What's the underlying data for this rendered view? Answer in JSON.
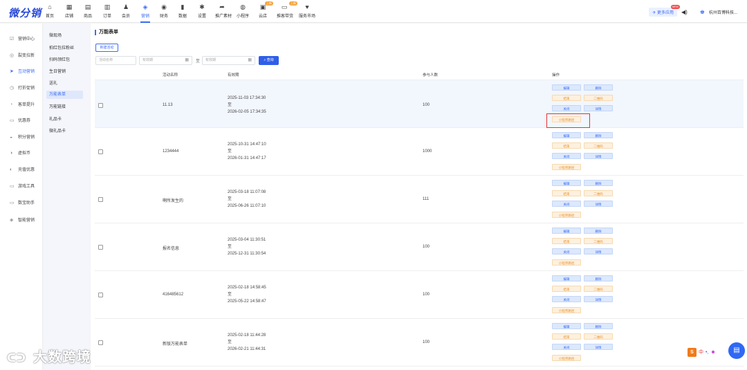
{
  "app": {
    "logo": "微分销"
  },
  "topnav": [
    {
      "label": "首页",
      "icon": "home-icon",
      "glyph": "⌂"
    },
    {
      "label": "店铺",
      "icon": "store-icon",
      "glyph": "▦"
    },
    {
      "label": "商品",
      "icon": "product-icon",
      "glyph": "▤"
    },
    {
      "label": "订单",
      "icon": "order-icon",
      "glyph": "▥"
    },
    {
      "label": "会员",
      "icon": "member-icon",
      "glyph": "♟"
    },
    {
      "label": "营销",
      "icon": "marketing-icon",
      "glyph": "◈"
    },
    {
      "label": "财务",
      "icon": "finance-icon",
      "glyph": "◉"
    },
    {
      "label": "数据",
      "icon": "data-icon",
      "glyph": "▮"
    },
    {
      "label": "设置",
      "icon": "settings-icon",
      "glyph": "✱"
    },
    {
      "label": "推广素材",
      "icon": "share-icon",
      "glyph": "➦"
    },
    {
      "label": "小程序",
      "icon": "miniprogram-icon",
      "glyph": "◍"
    },
    {
      "label": "云店",
      "icon": "cloud-store-icon",
      "glyph": "▣",
      "badge": "上新"
    },
    {
      "label": "推客带货",
      "icon": "promoter-icon",
      "glyph": "▭",
      "badge": "上新"
    },
    {
      "label": "服务市场",
      "icon": "service-market-icon",
      "glyph": "♥"
    }
  ],
  "topright": {
    "more_apps": "更多应用",
    "more_badge": "NEW",
    "company": "杭州百博科技..."
  },
  "sidebar1": [
    {
      "label": "营销中心",
      "glyph": "☑"
    },
    {
      "label": "裂变拉新",
      "glyph": "◎"
    },
    {
      "label": "互动营销",
      "glyph": "➤"
    },
    {
      "label": "打折促销",
      "glyph": "◷"
    },
    {
      "label": "客单提升",
      "glyph": "◔"
    },
    {
      "label": "优惠券",
      "glyph": "▭"
    },
    {
      "label": "积分营销",
      "glyph": "◒"
    },
    {
      "label": "虚拟币",
      "glyph": "◑"
    },
    {
      "label": "充值优惠",
      "glyph": "◐"
    },
    {
      "label": "游戏工具",
      "glyph": "▭"
    },
    {
      "label": "数宝助手",
      "glyph": "▭"
    },
    {
      "label": "智能营销",
      "glyph": "◈"
    }
  ],
  "sidebar2": [
    "微现场",
    "拍红包拉粉丝",
    "扫码领红包",
    "生日营销",
    "送礼",
    "万能表单",
    "万能链接",
    "礼品卡",
    "微礼品卡"
  ],
  "page": {
    "title": "万能表单",
    "new_button": "新建活动",
    "name_placeholder": "活动名称",
    "date_start_placeholder": "有效期",
    "date_to": "至",
    "date_end_placeholder": "有效期",
    "query_button": "查询"
  },
  "table": {
    "headers": [
      "活动名称",
      "有效期",
      "参与人数",
      "操作"
    ],
    "to_word": "至",
    "ops": {
      "edit": "编辑",
      "delete": "删除",
      "stop": "结束",
      "qrcode": "二维码",
      "close": "关闭",
      "detail": "详情",
      "mini_path": "小程序路径"
    },
    "rows": [
      {
        "name": "11.13",
        "start": "2025-11-03 17:34:30",
        "end": "2026-02-05 17:34:35",
        "count": "100"
      },
      {
        "name": "1234444",
        "start": "2025-10-31 14:47:10",
        "end": "2026-01-31 14:47:17",
        "count": "1000"
      },
      {
        "name": "啊所发生的",
        "start": "2025-03-18 11:07:08",
        "end": "2025-06-26 11:07:10",
        "count": "111"
      },
      {
        "name": "报名信息",
        "start": "2025-03-04 11:30:51",
        "end": "2025-12-31 11:30:54",
        "count": "100"
      },
      {
        "name": "416485612",
        "start": "2025-02-18 14:58:45",
        "end": "2025-05-22 14:58:47",
        "count": "100"
      },
      {
        "name": "新版万能表单",
        "start": "2025-02-18 11:44:28",
        "end": "2026-02-21 11:44:31",
        "count": "100"
      }
    ]
  },
  "overlay": {
    "watermark": "大数跨境",
    "ime_s": "S",
    "ime_zh": "中"
  }
}
